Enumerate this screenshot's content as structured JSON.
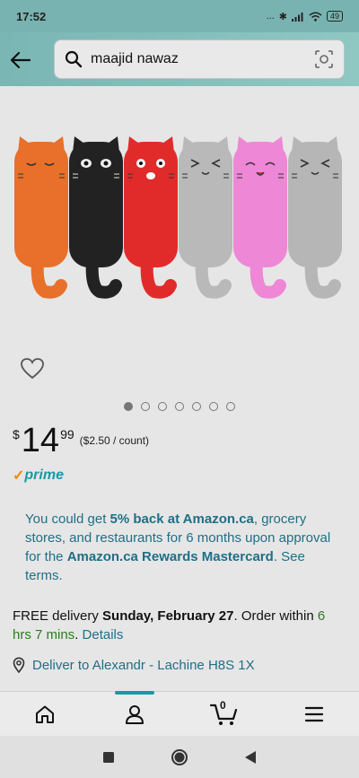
{
  "status": {
    "time": "17:52",
    "battery": "49",
    "dots": "...",
    "bt": "✱"
  },
  "search": {
    "query": "maajid nawaz"
  },
  "product": {
    "price_currency": "$",
    "price_whole": "14",
    "price_cents": "99",
    "price_per_unit": "($2.50 / count)",
    "prime_label": "prime",
    "image_count": 7,
    "active_image_index": 0
  },
  "offer": {
    "part1": "You could get ",
    "bold1": "5% back at Amazon.ca",
    "part2": ", grocery stores, and restaurants for 6 months upon approval for the ",
    "bold2": "Amazon.ca Rewards Mastercard",
    "part3": ". ",
    "terms_link": "See terms."
  },
  "delivery": {
    "prefix": "FREE delivery ",
    "date": "Sunday, February 27",
    "middle": ". Order within ",
    "countdown": "6 hrs 7 mins",
    "suffix": ". ",
    "details_link": "Details"
  },
  "deliver_to": {
    "label": "Deliver to Alexandr - Lachine H8S 1X"
  },
  "nav": {
    "cart_count": "0",
    "active": "account"
  },
  "colors": {
    "accent": "#1a98a5",
    "prime_check": "#f08804",
    "green": "#2a7d1e",
    "header": "#7ab6b4"
  },
  "cats": [
    {
      "body": "#e8702a",
      "face": "sleepy"
    },
    {
      "body": "#222222",
      "face": "eyes"
    },
    {
      "body": "#e12b2b",
      "face": "surprised"
    },
    {
      "body": "#b9b9b9",
      "face": "squint"
    },
    {
      "body": "#ee87d6",
      "face": "happy"
    },
    {
      "body": "#b6b6b6",
      "face": "squint"
    }
  ]
}
